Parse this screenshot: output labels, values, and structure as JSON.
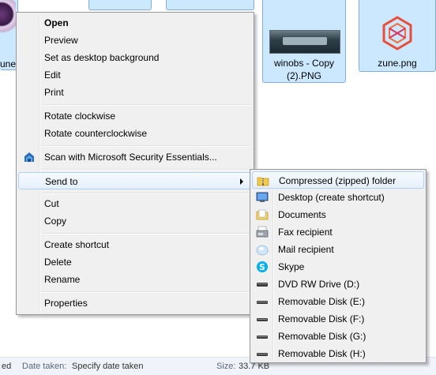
{
  "files": [
    {
      "label": "unes"
    },
    {
      "label": "winobs - Copy (2).PNG"
    },
    {
      "label": "zune.png"
    }
  ],
  "context_menu": {
    "items": [
      {
        "label": "Open",
        "bold": true
      },
      {
        "label": "Preview"
      },
      {
        "label": "Set as desktop background"
      },
      {
        "label": "Edit"
      },
      {
        "label": "Print"
      },
      {
        "label": "Rotate clockwise"
      },
      {
        "label": "Rotate counterclockwise"
      },
      {
        "label": "Scan with Microsoft Security Essentials...",
        "icon": "shield-icon"
      },
      {
        "label": "Send to",
        "submenu": true,
        "highlighted": true
      },
      {
        "label": "Cut"
      },
      {
        "label": "Copy"
      },
      {
        "label": "Create shortcut"
      },
      {
        "label": "Delete"
      },
      {
        "label": "Rename"
      },
      {
        "label": "Properties"
      }
    ]
  },
  "send_to_menu": {
    "items": [
      {
        "label": "Compressed (zipped) folder",
        "icon": "zip-folder-icon",
        "highlighted": true
      },
      {
        "label": "Desktop (create shortcut)",
        "icon": "desktop-icon"
      },
      {
        "label": "Documents",
        "icon": "documents-icon"
      },
      {
        "label": "Fax recipient",
        "icon": "fax-icon"
      },
      {
        "label": "Mail recipient",
        "icon": "mail-icon"
      },
      {
        "label": "Skype",
        "icon": "skype-icon"
      },
      {
        "label": "DVD RW Drive (D:)",
        "icon": "dvd-drive-icon"
      },
      {
        "label": "Removable Disk (E:)",
        "icon": "removable-disk-icon"
      },
      {
        "label": "Removable Disk (F:)",
        "icon": "removable-disk-icon"
      },
      {
        "label": "Removable Disk (G:)",
        "icon": "removable-disk-icon"
      },
      {
        "label": "Removable Disk (H:)",
        "icon": "removable-disk-icon"
      }
    ]
  },
  "status_bar": {
    "left_fragment": "ed",
    "date_taken_label": "Date taken:",
    "date_taken_value": "Specify date taken",
    "size_label": "Size:",
    "size_value": "33.7 KB"
  }
}
